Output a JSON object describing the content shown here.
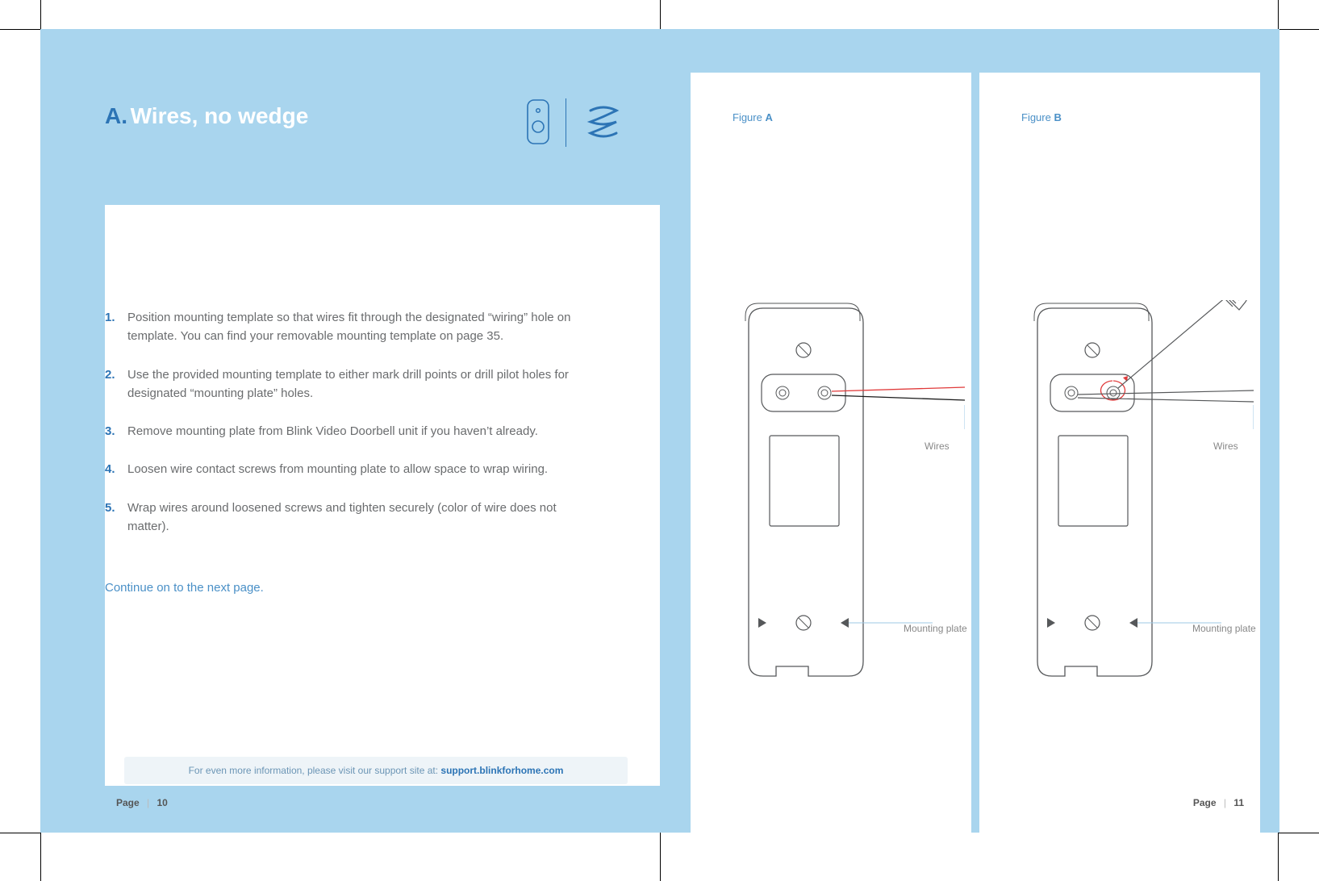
{
  "header": {
    "prefix": "A.",
    "title": "Wires, no wedge"
  },
  "icons": {
    "doorbell": "doorbell-icon",
    "wire": "wire-icon"
  },
  "steps": [
    {
      "n": "1.",
      "text": "Position mounting template so that wires fit through the designated “wiring” hole on template. You can find your removable mounting template on page 35."
    },
    {
      "n": "2.",
      "text": "Use the provided mounting template to either mark drill points or drill pilot holes for designated “mounting plate” holes."
    },
    {
      "n": "3.",
      "text": "Remove mounting plate from Blink Video Doorbell unit if you haven’t already."
    },
    {
      "n": "4.",
      "text": "Loosen wire contact screws from mounting plate to allow space to wrap wiring."
    },
    {
      "n": "5.",
      "text": "Wrap wires around loosened screws and tighten securely  (color of wire does not matter)."
    }
  ],
  "continue_text": "Continue on to the next page.",
  "support": {
    "lead": "For even more information, please visit our support site at: ",
    "link": "support.blinkforhome.com"
  },
  "figures": {
    "a": {
      "prefix": "Figure ",
      "id": "A",
      "wires_label": "Wires",
      "plate_label": "Mounting plate"
    },
    "b": {
      "prefix": "Figure ",
      "id": "B",
      "wires_label": "Wires",
      "plate_label": "Mounting plate"
    }
  },
  "page_numbers": {
    "left": {
      "word": "Page",
      "sep": "|",
      "num": "10"
    },
    "right": {
      "word": "Page",
      "sep": "|",
      "num": "11"
    }
  },
  "colors": {
    "brand_blue": "#2c74b5",
    "page_blue": "#a9d5ee",
    "accent_red": "#e03a3a"
  }
}
